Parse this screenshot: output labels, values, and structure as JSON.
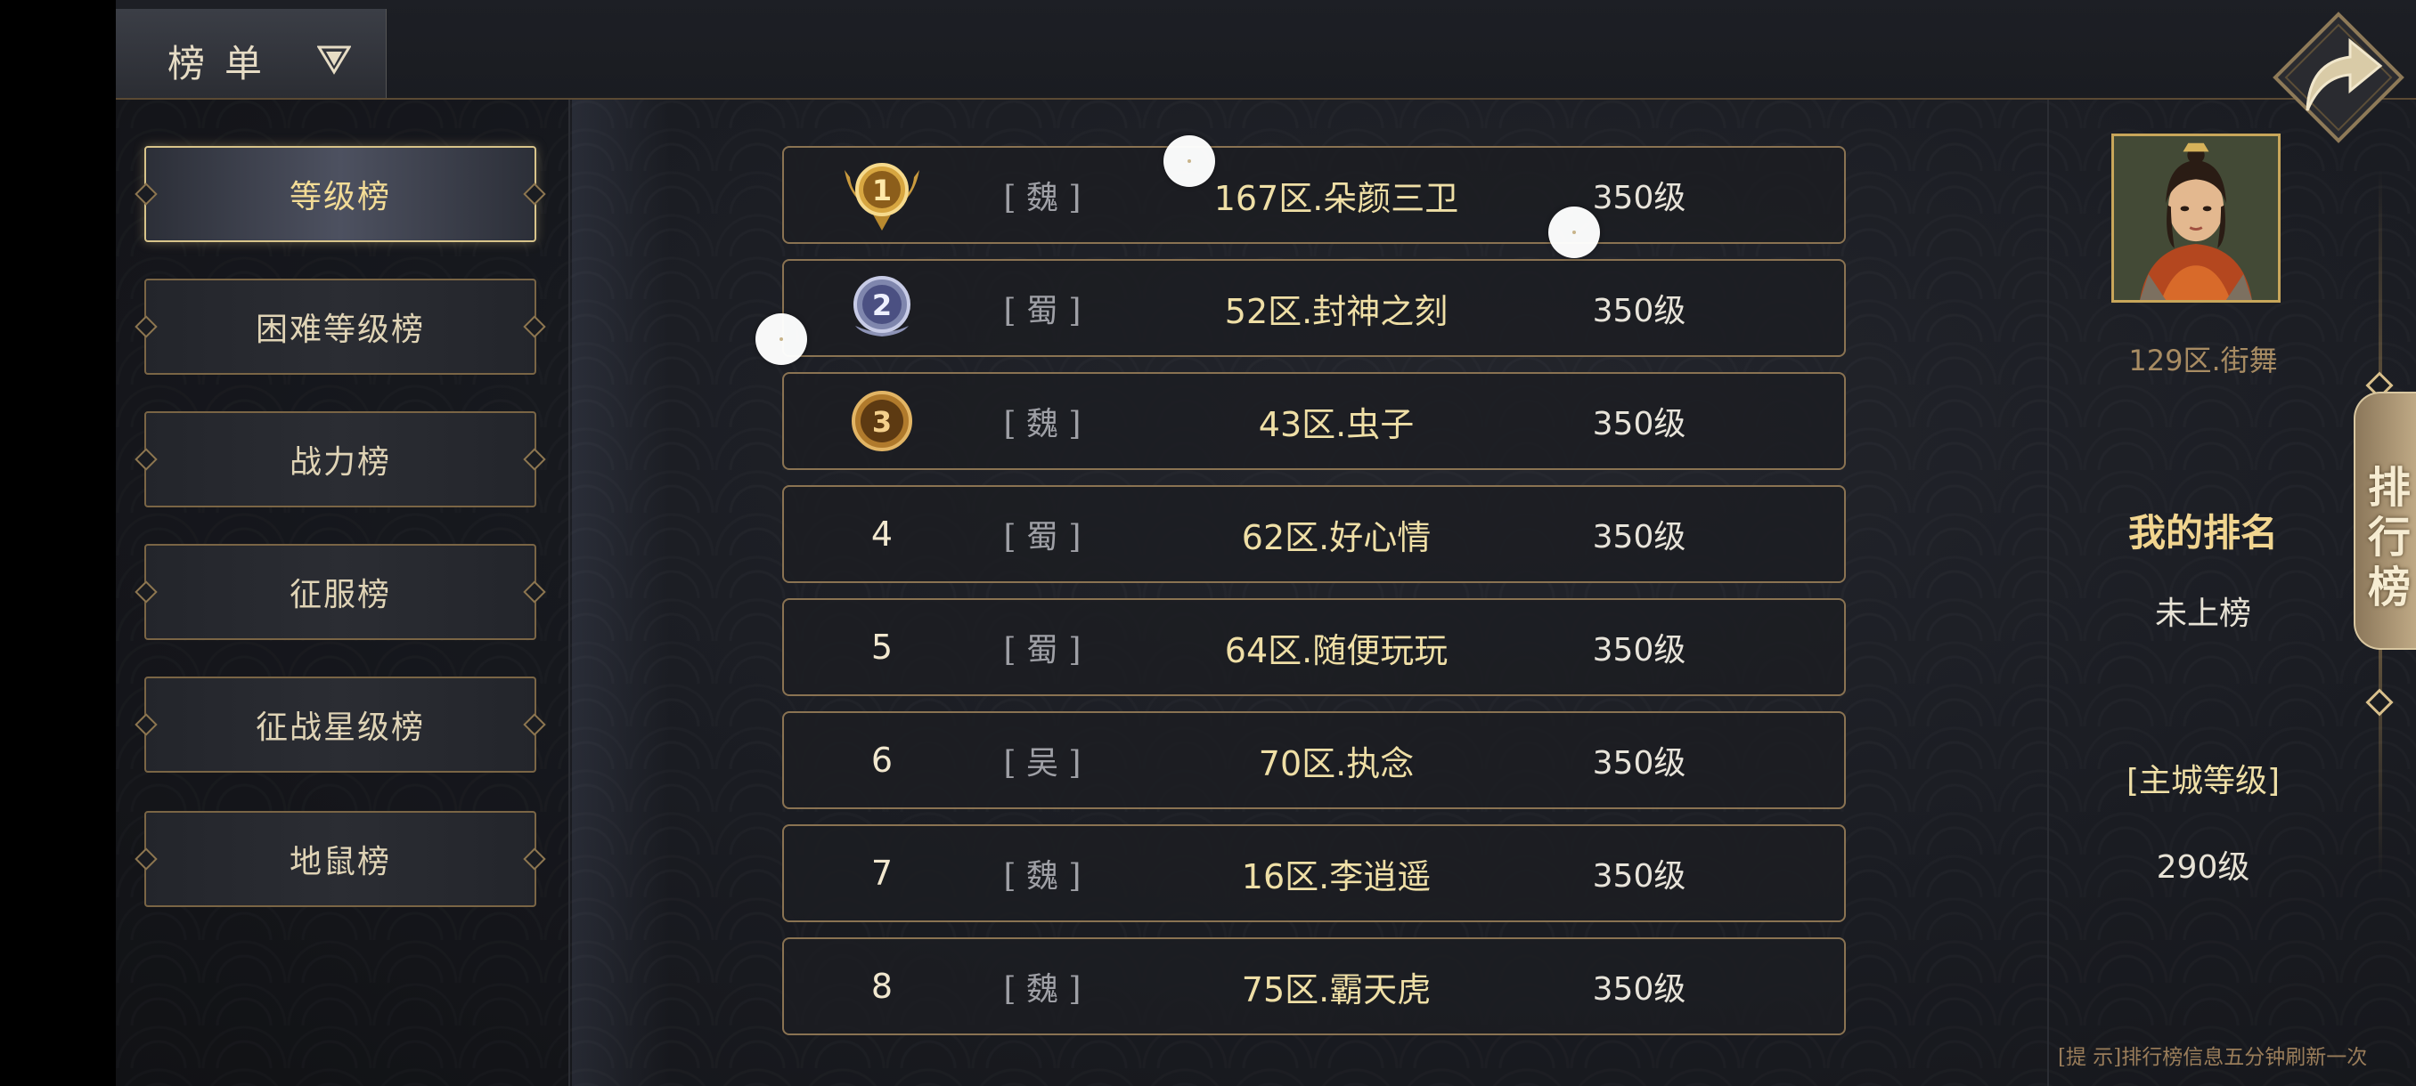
{
  "header": {
    "title": "榜单"
  },
  "menu": {
    "items": [
      {
        "label": "等级榜",
        "active": true
      },
      {
        "label": "困难等级榜",
        "active": false
      },
      {
        "label": "战力榜",
        "active": false
      },
      {
        "label": "征服榜",
        "active": false
      },
      {
        "label": "征战星级榜",
        "active": false
      },
      {
        "label": "地鼠榜",
        "active": false
      }
    ]
  },
  "ranking": {
    "rows": [
      {
        "rank": "1",
        "rank_icon": "gold-medal-icon",
        "kingdom": "[ 魏 ]",
        "name": "167区.朵颜三卫",
        "level": "350级"
      },
      {
        "rank": "2",
        "rank_icon": "silver-medal-icon",
        "kingdom": "[ 蜀 ]",
        "name": "52区.封神之刻",
        "level": "350级"
      },
      {
        "rank": "3",
        "rank_icon": "bronze-medal-icon",
        "kingdom": "[ 魏 ]",
        "name": "43区.虫子",
        "level": "350级"
      },
      {
        "rank": "4",
        "kingdom": "[ 蜀 ]",
        "name": "62区.好心情",
        "level": "350级"
      },
      {
        "rank": "5",
        "kingdom": "[ 蜀 ]",
        "name": "64区.随便玩玩",
        "level": "350级"
      },
      {
        "rank": "6",
        "kingdom": "[ 吴 ]",
        "name": "70区.执念",
        "level": "350级"
      },
      {
        "rank": "7",
        "kingdom": "[ 魏 ]",
        "name": "16区.李逍遥",
        "level": "350级"
      },
      {
        "rank": "8",
        "kingdom": "[ 魏 ]",
        "name": "75区.霸天虎",
        "level": "350级"
      }
    ]
  },
  "player": {
    "name": "129区.街舞",
    "my_rank_title": "我的排名",
    "my_rank_value": "未上榜",
    "city_title": "[主城等级]",
    "city_value": "290级"
  },
  "side_tab": {
    "label": "排行榜"
  },
  "hint": "[提 示]排行榜信息五分钟刷新一次",
  "colors": {
    "accent_gold": "#efdfa6",
    "border_bronze": "#8a7352",
    "background": "#1a1c22"
  }
}
